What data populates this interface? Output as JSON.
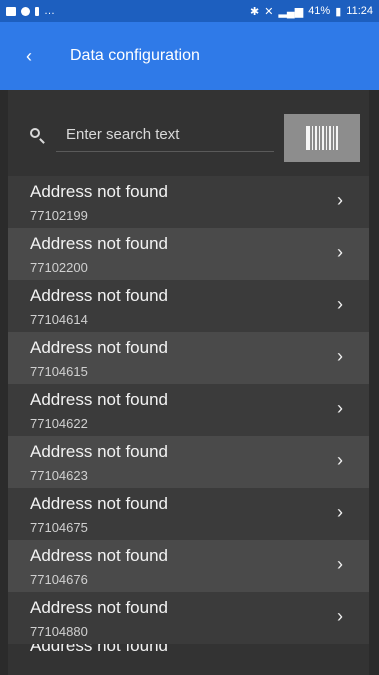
{
  "status_bar": {
    "battery_percent": "41%",
    "time": "11:24"
  },
  "header": {
    "back_icon": "chevron-left-icon",
    "title": "Data configuration"
  },
  "search": {
    "placeholder": "Enter search text",
    "scan_icon": "barcode-icon"
  },
  "items": [
    {
      "title": "Address not found",
      "id": "77102199"
    },
    {
      "title": "Address not found",
      "id": "77102200"
    },
    {
      "title": "Address not found",
      "id": "77104614"
    },
    {
      "title": "Address not found",
      "id": "77104615"
    },
    {
      "title": "Address not found",
      "id": "77104622"
    },
    {
      "title": "Address not found",
      "id": "77104623"
    },
    {
      "title": "Address not found",
      "id": "77104675"
    },
    {
      "title": "Address not found",
      "id": "77104676"
    },
    {
      "title": "Address not found",
      "id": "77104880"
    }
  ],
  "cut_item": {
    "title": "Address not found"
  },
  "colors": {
    "appbar": "#2f7ae8",
    "statusbar": "#1d5fbf",
    "background": "#333333"
  }
}
